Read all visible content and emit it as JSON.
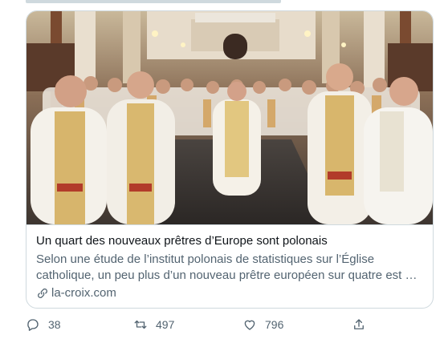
{
  "card": {
    "title": "Un quart des nouveaux prêtres d’Europe sont polonais",
    "description": "Selon une étude de l’institut polonais de statistiques sur l’Église catholique, un peu plus d’un nouveau prêtre européen sur quatre est …",
    "domain": "la-croix.com",
    "image_icon": "photo-priests-procession"
  },
  "actions": {
    "reply_count": "38",
    "retweet_count": "497",
    "like_count": "796",
    "reply_icon": "reply-icon",
    "retweet_icon": "retweet-icon",
    "like_icon": "heart-icon",
    "share_icon": "share-icon"
  },
  "colors": {
    "text_primary": "#0f1419",
    "text_secondary": "#536471",
    "border": "#cfd9de"
  }
}
